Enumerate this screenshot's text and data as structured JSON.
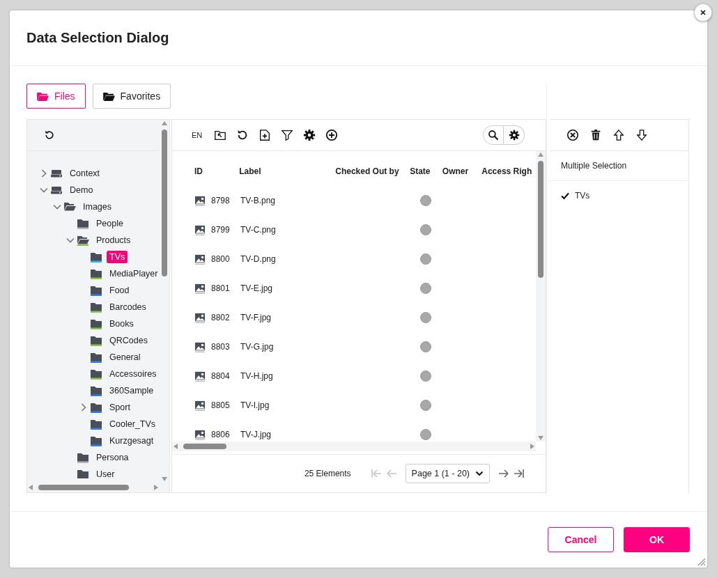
{
  "dialog": {
    "title": "Data Selection Dialog"
  },
  "source_tabs": [
    {
      "label": "Files",
      "selected": true
    },
    {
      "label": "Favorites",
      "selected": false
    }
  ],
  "tree": [
    {
      "label": "Context",
      "kind": "drive",
      "expanded": false,
      "selected": false
    },
    {
      "label": "Demo",
      "kind": "drive",
      "expanded": true,
      "selected": false,
      "children": [
        {
          "label": "Images",
          "kind": "folder",
          "expanded": true,
          "selected": false,
          "children": [
            {
              "label": "People",
              "kind": "folder",
              "selected": false,
              "color": "#b4b4b4"
            },
            {
              "label": "Products",
              "kind": "folder",
              "expanded": true,
              "selected": false,
              "color": "#8bc34a",
              "children": [
                {
                  "label": "TVs",
                  "kind": "folder",
                  "selected": true,
                  "color": "#29b6f6"
                },
                {
                  "label": "MediaPlayer",
                  "kind": "folder",
                  "selected": false,
                  "color": "#8bc34a"
                },
                {
                  "label": "Food",
                  "kind": "folder",
                  "selected": false,
                  "color": "#2f7bf5"
                },
                {
                  "label": "Barcodes",
                  "kind": "folder",
                  "selected": false,
                  "color": "#8bc34a"
                },
                {
                  "label": "Books",
                  "kind": "folder",
                  "selected": false,
                  "color": "#8bc34a"
                },
                {
                  "label": "QRCodes",
                  "kind": "folder",
                  "selected": false,
                  "color": "#8bc34a"
                },
                {
                  "label": "General",
                  "kind": "folder",
                  "selected": false,
                  "color": "#2f7bf5"
                },
                {
                  "label": "Accessoires",
                  "kind": "folder",
                  "selected": false,
                  "color": "#8bc34a"
                },
                {
                  "label": "360Sample",
                  "kind": "folder",
                  "selected": false,
                  "color": "#2f7bf5"
                },
                {
                  "label": "Sport",
                  "kind": "folder",
                  "expanded": false,
                  "selected": false,
                  "color": "#2f7bf5"
                },
                {
                  "label": "Cooler_TVs",
                  "kind": "folder",
                  "selected": false,
                  "color": "#2f7bf5"
                },
                {
                  "label": "Kurzgesagt",
                  "kind": "folder",
                  "selected": false,
                  "color": "#2f7bf5"
                }
              ]
            },
            {
              "label": "Persona",
              "kind": "folder",
              "selected": false,
              "color": "#b4b4b4"
            },
            {
              "label": "User",
              "kind": "folder",
              "selected": false
            }
          ]
        }
      ]
    }
  ],
  "file_toolbar": {
    "language": "EN"
  },
  "table": {
    "columns": [
      "ID",
      "Label",
      "Checked Out by",
      "State",
      "Owner",
      "Access Righ"
    ],
    "rows": [
      {
        "id": "8798",
        "label": "TV-B.png"
      },
      {
        "id": "8799",
        "label": "TV-C.png"
      },
      {
        "id": "8800",
        "label": "TV-D.png"
      },
      {
        "id": "8801",
        "label": "TV-E.jpg"
      },
      {
        "id": "8802",
        "label": "TV-F.jpg"
      },
      {
        "id": "8803",
        "label": "TV-G.jpg"
      },
      {
        "id": "8804",
        "label": "TV-H.jpg"
      },
      {
        "id": "8805",
        "label": "TV-I.jpg"
      },
      {
        "id": "8806",
        "label": "TV-J.jpg"
      }
    ]
  },
  "pagination": {
    "count": "25 Elements",
    "page": "Page 1 (1 - 20)",
    "first_disabled": true,
    "prev_disabled": true,
    "next_disabled": false,
    "last_disabled": false
  },
  "selection_panel": {
    "heading": "Multiple Selection",
    "items": [
      {
        "label": "TVs",
        "checked": true
      }
    ]
  },
  "buttons": [
    {
      "label": "Cancel",
      "kind": "secondary"
    },
    {
      "label": "OK",
      "kind": "primary"
    }
  ]
}
